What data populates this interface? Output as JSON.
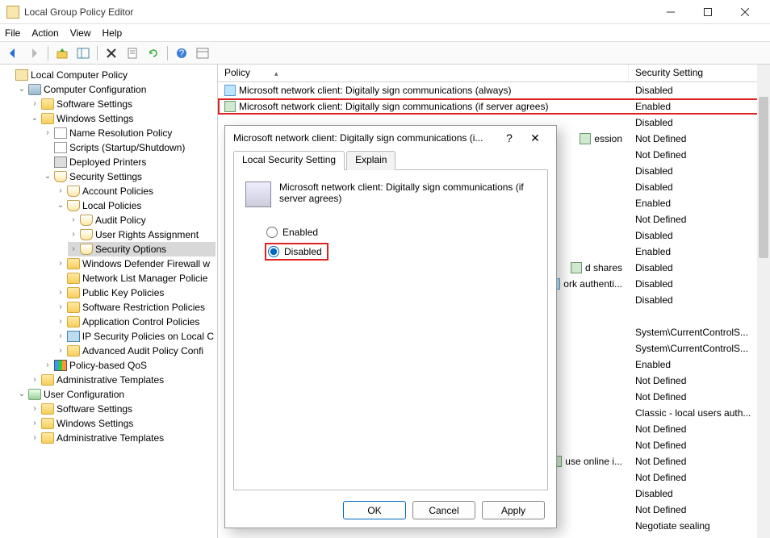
{
  "window": {
    "title": "Local Group Policy Editor"
  },
  "menubar": [
    "File",
    "Action",
    "View",
    "Help"
  ],
  "tree": {
    "root": "Local Computer Policy",
    "comp_config": "Computer Configuration",
    "sw_settings": "Software Settings",
    "win_settings": "Windows Settings",
    "name_res": "Name Resolution Policy",
    "scripts": "Scripts (Startup/Shutdown)",
    "deployed_printers": "Deployed Printers",
    "security_settings": "Security Settings",
    "account_policies": "Account Policies",
    "local_policies": "Local Policies",
    "audit_policy": "Audit Policy",
    "user_rights": "User Rights Assignment",
    "security_options": "Security Options",
    "defender": "Windows Defender Firewall w",
    "netlist": "Network List Manager Policie",
    "pubkey": "Public Key Policies",
    "swrestrict": "Software Restriction Policies",
    "appcontrol": "Application Control Policies",
    "ipsec": "IP Security Policies on Local C",
    "advaudit": "Advanced Audit Policy Confi",
    "qos": "Policy-based QoS",
    "admin_templates": "Administrative Templates",
    "user_config": "User Configuration",
    "u_sw": "Software Settings",
    "u_win": "Windows Settings",
    "u_admin": "Administrative Templates"
  },
  "list": {
    "col_policy": "Policy",
    "col_setting": "Security Setting",
    "rows": [
      {
        "name": "Microsoft network client: Digitally sign communications (always)",
        "value": "Disabled"
      },
      {
        "name": "Microsoft network client: Digitally sign communications (if server agrees)",
        "value": "Enabled",
        "highlight": true
      },
      {
        "name_frag": "",
        "value": "Disabled"
      },
      {
        "name_frag": "ession",
        "value": "Not Defined"
      },
      {
        "name_frag": "",
        "value": "Not Defined"
      },
      {
        "name_frag": "",
        "value": "Disabled"
      },
      {
        "name_frag": "",
        "value": "Disabled"
      },
      {
        "name_frag": "",
        "value": "Enabled"
      },
      {
        "name_frag": "",
        "value": "Not Defined"
      },
      {
        "name_frag": "",
        "value": "Disabled"
      },
      {
        "name_frag": "",
        "value": "Enabled"
      },
      {
        "name_frag": "d shares",
        "value": "Disabled"
      },
      {
        "name_frag": "ork authenti...",
        "value": "Disabled"
      },
      {
        "name_frag": "",
        "value": "Disabled"
      },
      {
        "name_frag": "",
        "value": ""
      },
      {
        "name_frag": "",
        "value": "System\\CurrentControlS..."
      },
      {
        "name_frag": "",
        "value": "System\\CurrentControlS..."
      },
      {
        "name_frag": "",
        "value": "Enabled"
      },
      {
        "name_frag": "",
        "value": "Not Defined"
      },
      {
        "name_frag": "",
        "value": "Not Defined"
      },
      {
        "name_frag": "",
        "value": "Classic - local users auth..."
      },
      {
        "name_frag": "",
        "value": "Not Defined"
      },
      {
        "name_frag": "",
        "value": "Not Defined"
      },
      {
        "name_frag": "use online i...",
        "value": "Not Defined"
      },
      {
        "name_frag": "",
        "value": "Not Defined"
      },
      {
        "name_frag": "",
        "value": "Disabled"
      },
      {
        "name_frag": "",
        "value": "Not Defined"
      },
      {
        "name_frag": "",
        "value": "Negotiate sealing"
      }
    ]
  },
  "dialog": {
    "title": "Microsoft network client: Digitally sign communications (i...",
    "tab_local": "Local Security Setting",
    "tab_explain": "Explain",
    "description": "Microsoft network client: Digitally sign communications (if server agrees)",
    "opt_enabled": "Enabled",
    "opt_disabled": "Disabled",
    "btn_ok": "OK",
    "btn_cancel": "Cancel",
    "btn_apply": "Apply"
  }
}
